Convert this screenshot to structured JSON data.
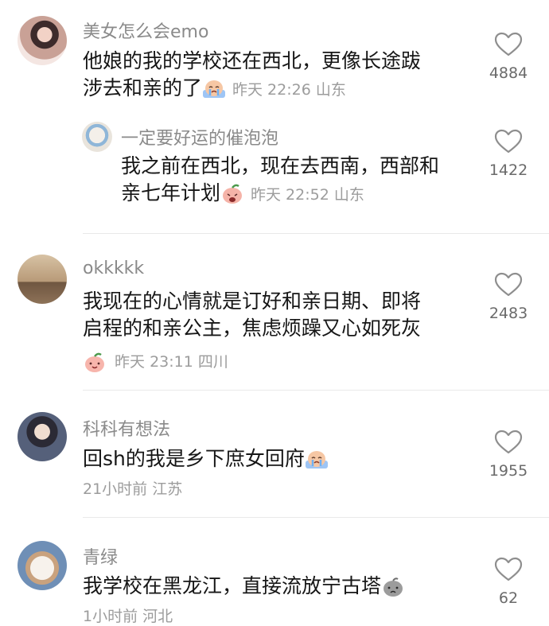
{
  "comments": [
    {
      "username": "美女怎么会emo",
      "text_line1": "他娘的我的学校还在西北，更像长途跋",
      "text_line2": "涉去和亲的了",
      "time": "昨天 22:26",
      "location": "山东",
      "likes": "4884",
      "emoji": "crying-face-icon"
    },
    {
      "username": "一定要好运的催泡泡",
      "text_line1": "我之前在西北，现在去西南，西部和",
      "text_line2": "亲七年计划",
      "time": "昨天 22:52",
      "location": "山东",
      "likes": "1422",
      "emoji": "peach-sob-icon"
    },
    {
      "username": "okkkkk",
      "text_line1": "我现在的心情就是订好和亲日期、即将",
      "text_line2": "启程的和亲公主，焦虑烦躁又心如死灰",
      "time": "昨天 23:11",
      "location": "四川",
      "likes": "2483",
      "emoji": "peach-smile-icon"
    },
    {
      "username": "科科有想法",
      "text_line1": "回sh的我是乡下庶女回府",
      "time": "21小时前",
      "location": "江苏",
      "likes": "1955",
      "emoji": "crying-face-icon"
    },
    {
      "username": "青绿",
      "text_line1": "我学校在黑龙江，直接流放宁古塔",
      "time": "1小时前",
      "location": "河北",
      "likes": "62",
      "emoji": "gray-sad-face-icon"
    }
  ]
}
